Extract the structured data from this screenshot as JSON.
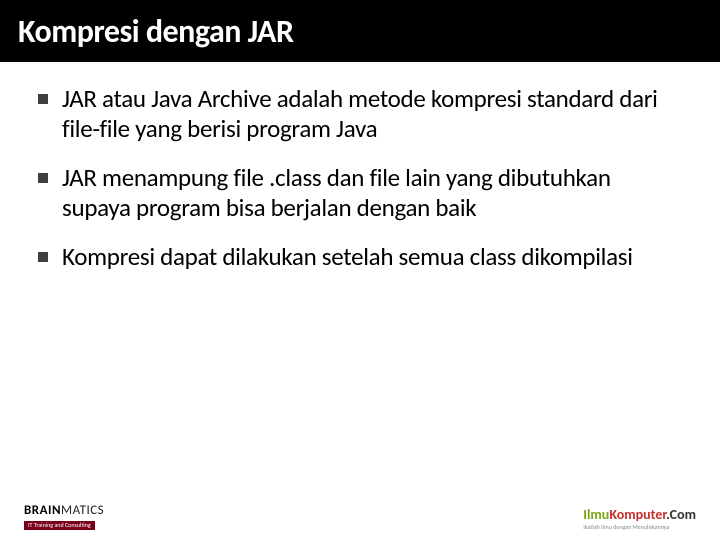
{
  "header": {
    "title": "Kompresi dengan JAR"
  },
  "bullets": [
    {
      "text": "JAR atau Java Archive adalah metode kompresi standard dari file-file yang berisi program Java"
    },
    {
      "text": "JAR menampung file .class dan file lain yang dibutuhkan supaya program bisa berjalan dengan baik"
    },
    {
      "text": "Kompresi dapat dilakukan setelah semua class dikompilasi"
    }
  ],
  "footer": {
    "left_brand_1": "BRAIN",
    "left_brand_2": "MATICS",
    "left_tagline": "IT Training and Consulting",
    "right_part1": "Ilmu",
    "right_part2": "Komputer",
    "right_part3": ".Com",
    "right_sub": "Ikatlah Ilmu dengan Menuliskannya"
  }
}
